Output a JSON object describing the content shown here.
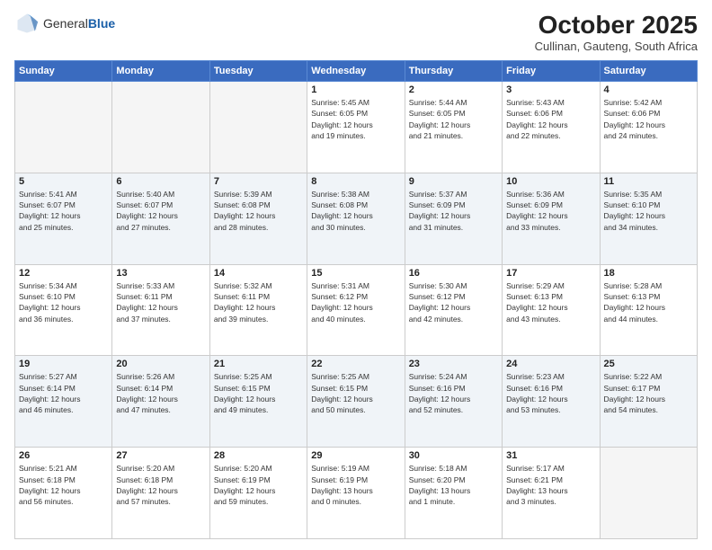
{
  "logo": {
    "general": "General",
    "blue": "Blue"
  },
  "header": {
    "month": "October 2025",
    "location": "Cullinan, Gauteng, South Africa"
  },
  "weekdays": [
    "Sunday",
    "Monday",
    "Tuesday",
    "Wednesday",
    "Thursday",
    "Friday",
    "Saturday"
  ],
  "weeks": [
    [
      {
        "day": "",
        "info": ""
      },
      {
        "day": "",
        "info": ""
      },
      {
        "day": "",
        "info": ""
      },
      {
        "day": "1",
        "info": "Sunrise: 5:45 AM\nSunset: 6:05 PM\nDaylight: 12 hours\nand 19 minutes."
      },
      {
        "day": "2",
        "info": "Sunrise: 5:44 AM\nSunset: 6:05 PM\nDaylight: 12 hours\nand 21 minutes."
      },
      {
        "day": "3",
        "info": "Sunrise: 5:43 AM\nSunset: 6:06 PM\nDaylight: 12 hours\nand 22 minutes."
      },
      {
        "day": "4",
        "info": "Sunrise: 5:42 AM\nSunset: 6:06 PM\nDaylight: 12 hours\nand 24 minutes."
      }
    ],
    [
      {
        "day": "5",
        "info": "Sunrise: 5:41 AM\nSunset: 6:07 PM\nDaylight: 12 hours\nand 25 minutes."
      },
      {
        "day": "6",
        "info": "Sunrise: 5:40 AM\nSunset: 6:07 PM\nDaylight: 12 hours\nand 27 minutes."
      },
      {
        "day": "7",
        "info": "Sunrise: 5:39 AM\nSunset: 6:08 PM\nDaylight: 12 hours\nand 28 minutes."
      },
      {
        "day": "8",
        "info": "Sunrise: 5:38 AM\nSunset: 6:08 PM\nDaylight: 12 hours\nand 30 minutes."
      },
      {
        "day": "9",
        "info": "Sunrise: 5:37 AM\nSunset: 6:09 PM\nDaylight: 12 hours\nand 31 minutes."
      },
      {
        "day": "10",
        "info": "Sunrise: 5:36 AM\nSunset: 6:09 PM\nDaylight: 12 hours\nand 33 minutes."
      },
      {
        "day": "11",
        "info": "Sunrise: 5:35 AM\nSunset: 6:10 PM\nDaylight: 12 hours\nand 34 minutes."
      }
    ],
    [
      {
        "day": "12",
        "info": "Sunrise: 5:34 AM\nSunset: 6:10 PM\nDaylight: 12 hours\nand 36 minutes."
      },
      {
        "day": "13",
        "info": "Sunrise: 5:33 AM\nSunset: 6:11 PM\nDaylight: 12 hours\nand 37 minutes."
      },
      {
        "day": "14",
        "info": "Sunrise: 5:32 AM\nSunset: 6:11 PM\nDaylight: 12 hours\nand 39 minutes."
      },
      {
        "day": "15",
        "info": "Sunrise: 5:31 AM\nSunset: 6:12 PM\nDaylight: 12 hours\nand 40 minutes."
      },
      {
        "day": "16",
        "info": "Sunrise: 5:30 AM\nSunset: 6:12 PM\nDaylight: 12 hours\nand 42 minutes."
      },
      {
        "day": "17",
        "info": "Sunrise: 5:29 AM\nSunset: 6:13 PM\nDaylight: 12 hours\nand 43 minutes."
      },
      {
        "day": "18",
        "info": "Sunrise: 5:28 AM\nSunset: 6:13 PM\nDaylight: 12 hours\nand 44 minutes."
      }
    ],
    [
      {
        "day": "19",
        "info": "Sunrise: 5:27 AM\nSunset: 6:14 PM\nDaylight: 12 hours\nand 46 minutes."
      },
      {
        "day": "20",
        "info": "Sunrise: 5:26 AM\nSunset: 6:14 PM\nDaylight: 12 hours\nand 47 minutes."
      },
      {
        "day": "21",
        "info": "Sunrise: 5:25 AM\nSunset: 6:15 PM\nDaylight: 12 hours\nand 49 minutes."
      },
      {
        "day": "22",
        "info": "Sunrise: 5:25 AM\nSunset: 6:15 PM\nDaylight: 12 hours\nand 50 minutes."
      },
      {
        "day": "23",
        "info": "Sunrise: 5:24 AM\nSunset: 6:16 PM\nDaylight: 12 hours\nand 52 minutes."
      },
      {
        "day": "24",
        "info": "Sunrise: 5:23 AM\nSunset: 6:16 PM\nDaylight: 12 hours\nand 53 minutes."
      },
      {
        "day": "25",
        "info": "Sunrise: 5:22 AM\nSunset: 6:17 PM\nDaylight: 12 hours\nand 54 minutes."
      }
    ],
    [
      {
        "day": "26",
        "info": "Sunrise: 5:21 AM\nSunset: 6:18 PM\nDaylight: 12 hours\nand 56 minutes."
      },
      {
        "day": "27",
        "info": "Sunrise: 5:20 AM\nSunset: 6:18 PM\nDaylight: 12 hours\nand 57 minutes."
      },
      {
        "day": "28",
        "info": "Sunrise: 5:20 AM\nSunset: 6:19 PM\nDaylight: 12 hours\nand 59 minutes."
      },
      {
        "day": "29",
        "info": "Sunrise: 5:19 AM\nSunset: 6:19 PM\nDaylight: 13 hours\nand 0 minutes."
      },
      {
        "day": "30",
        "info": "Sunrise: 5:18 AM\nSunset: 6:20 PM\nDaylight: 13 hours\nand 1 minute."
      },
      {
        "day": "31",
        "info": "Sunrise: 5:17 AM\nSunset: 6:21 PM\nDaylight: 13 hours\nand 3 minutes."
      },
      {
        "day": "",
        "info": ""
      }
    ]
  ]
}
